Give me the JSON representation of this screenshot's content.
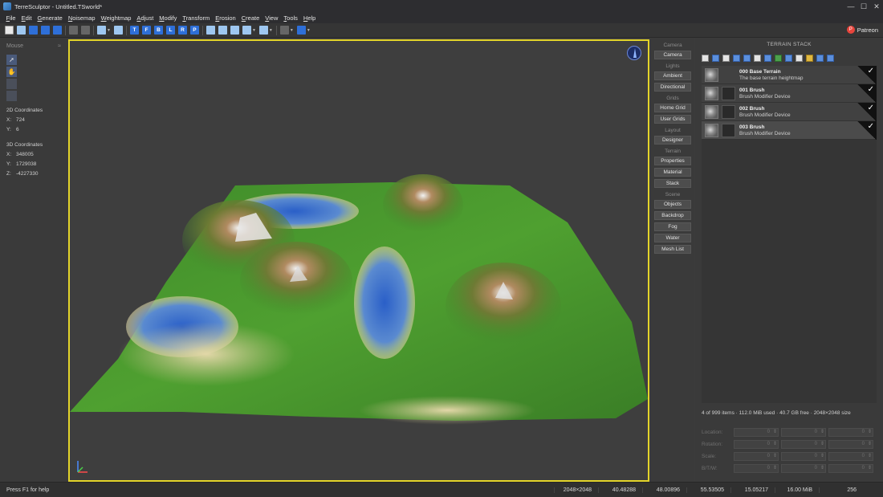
{
  "window": {
    "title": "TerreSculptor - Untitled.TSworld*",
    "controls": [
      "—",
      "☐",
      "✕"
    ]
  },
  "menubar": [
    {
      "label": "File",
      "mnemonic": "F",
      "rest": "ile"
    },
    {
      "label": "Edit",
      "mnemonic": "E",
      "rest": "dit"
    },
    {
      "label": "Generate",
      "mnemonic": "G",
      "rest": "enerate"
    },
    {
      "label": "Noisemap",
      "mnemonic": "N",
      "rest": "oisemap"
    },
    {
      "label": "Weightmap",
      "mnemonic": "W",
      "rest": "eightmap"
    },
    {
      "label": "Adjust",
      "mnemonic": "A",
      "rest": "djust"
    },
    {
      "label": "Modify",
      "mnemonic": "M",
      "rest": "odify"
    },
    {
      "label": "Transform",
      "mnemonic": "T",
      "rest": "ransform"
    },
    {
      "label": "Erosion",
      "mnemonic": "E",
      "rest": "rosion"
    },
    {
      "label": "Create",
      "mnemonic": "C",
      "rest": "reate"
    },
    {
      "label": "View",
      "mnemonic": "V",
      "rest": "iew"
    },
    {
      "label": "Tools",
      "mnemonic": "T",
      "rest": "ools"
    },
    {
      "label": "Help",
      "mnemonic": "H",
      "rest": "elp"
    }
  ],
  "toolbar": {
    "letter_buttons": [
      "T",
      "F",
      "B",
      "L",
      "R",
      "P"
    ],
    "patreon_label": "Patreon"
  },
  "left_panel": {
    "title": "Mouse",
    "collapse_glyph": "≈",
    "coords_2d_title": "2D Coordinates",
    "coords_2d": [
      {
        "k": "X:",
        "v": "724"
      },
      {
        "k": "Y:",
        "v": "6"
      }
    ],
    "coords_3d_title": "3D Coordinates",
    "coords_3d": [
      {
        "k": "X:",
        "v": "348005"
      },
      {
        "k": "Y:",
        "v": "1729038"
      },
      {
        "k": "Z:",
        "v": "-4227330"
      }
    ]
  },
  "mid_panel": {
    "sections": [
      {
        "label": "Camera",
        "buttons": [
          "Camera"
        ]
      },
      {
        "label": "Lights",
        "buttons": [
          "Ambient",
          "Directional"
        ]
      },
      {
        "label": "Grids",
        "buttons": [
          "Home Grid",
          "User Grids"
        ]
      },
      {
        "label": "Layout",
        "buttons": [
          "Designer"
        ]
      },
      {
        "label": "Terrain",
        "buttons": [
          "Properties",
          "Material",
          "Stack"
        ]
      },
      {
        "label": "Scene",
        "buttons": [
          "Objects",
          "Backdrop",
          "Fog",
          "Water",
          "Mesh List"
        ]
      }
    ]
  },
  "terrain_stack": {
    "title": "TERRAIN STACK",
    "layers": [
      {
        "name": "000 Base Terrain",
        "desc": "The base terrain heightmap",
        "has_mask": false,
        "selected": false
      },
      {
        "name": "001 Brush",
        "desc": "Brush Modifier Device",
        "has_mask": true,
        "selected": false
      },
      {
        "name": "002 Brush",
        "desc": "Brush Modifier Device",
        "has_mask": true,
        "selected": false
      },
      {
        "name": "003 Brush",
        "desc": "Brush Modifier Device",
        "has_mask": true,
        "selected": true
      }
    ],
    "check_glyph": "✓",
    "status": "4 of 999 items · 112.0 MiB used · 40.7 GB free · 2048×2048 size"
  },
  "transform": {
    "rows": [
      {
        "label": "Location:",
        "values": [
          "0",
          "0",
          "0"
        ]
      },
      {
        "label": "Rotation:",
        "values": [
          "0",
          "0",
          "0"
        ]
      },
      {
        "label": "Scale:",
        "values": [
          "0",
          "0",
          "0"
        ]
      },
      {
        "label": "B/T/W:",
        "values": [
          "0",
          "0",
          "0"
        ]
      }
    ]
  },
  "statusbar": {
    "help": "Press F1 for help",
    "values": [
      "2048×2048",
      "40.48288",
      "48.00896",
      "55.53505",
      "15.05217",
      "16.00 MiB",
      "256"
    ]
  },
  "colors": {
    "viewport_border": "#e3d42a",
    "accent_blue": "#2e6fd8",
    "patreon_red": "#e8453c"
  }
}
